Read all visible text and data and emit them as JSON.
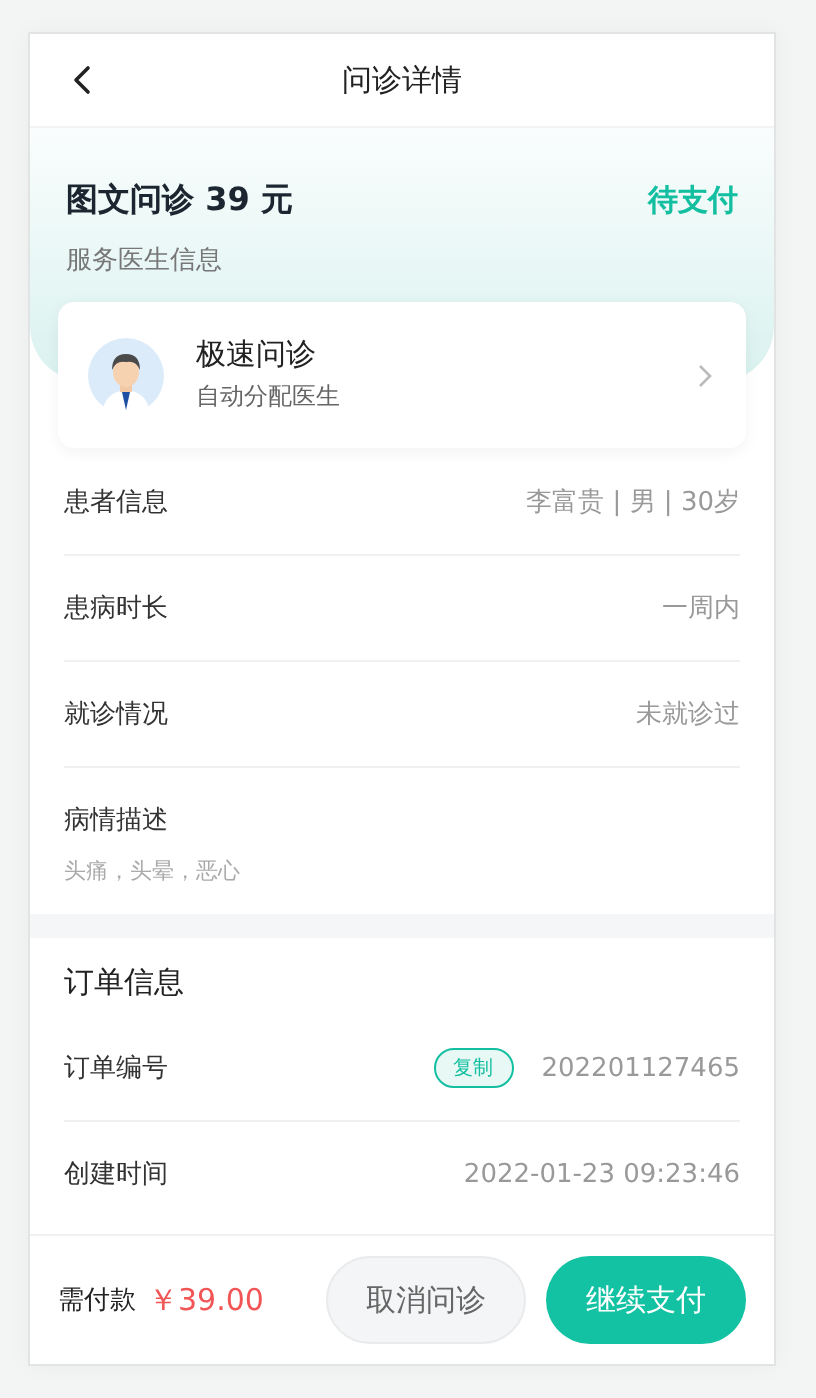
{
  "header": {
    "title": "问诊详情"
  },
  "consultation": {
    "title": "图文问诊 39 元",
    "status": "待支付",
    "subtitle": "服务医生信息",
    "doctor": {
      "name": "极速问诊",
      "note": "自动分配医生"
    }
  },
  "patient_rows": [
    {
      "kind": "inline",
      "label": "患者信息",
      "value": "李富贵 | 男 | 30岁"
    },
    {
      "kind": "inline",
      "label": "患病时长",
      "value": "一周内"
    },
    {
      "kind": "inline",
      "label": "就诊情况",
      "value": "未就诊过"
    },
    {
      "kind": "stacked",
      "label": "病情描述",
      "value": "头痛，头晕，恶心"
    }
  ],
  "order": {
    "title": "订单信息",
    "rows": [
      {
        "label": "订单编号",
        "copy_button": "复制",
        "value": "202201127465"
      },
      {
        "label": "创建时间",
        "value": "2022-01-23 09:23:46"
      }
    ]
  },
  "footer": {
    "amount_label": "需付款",
    "amount": "￥39.00",
    "buttons": [
      {
        "kind": "secondary",
        "label": "取消问诊"
      },
      {
        "kind": "primary",
        "label": "继续支付"
      }
    ]
  }
}
